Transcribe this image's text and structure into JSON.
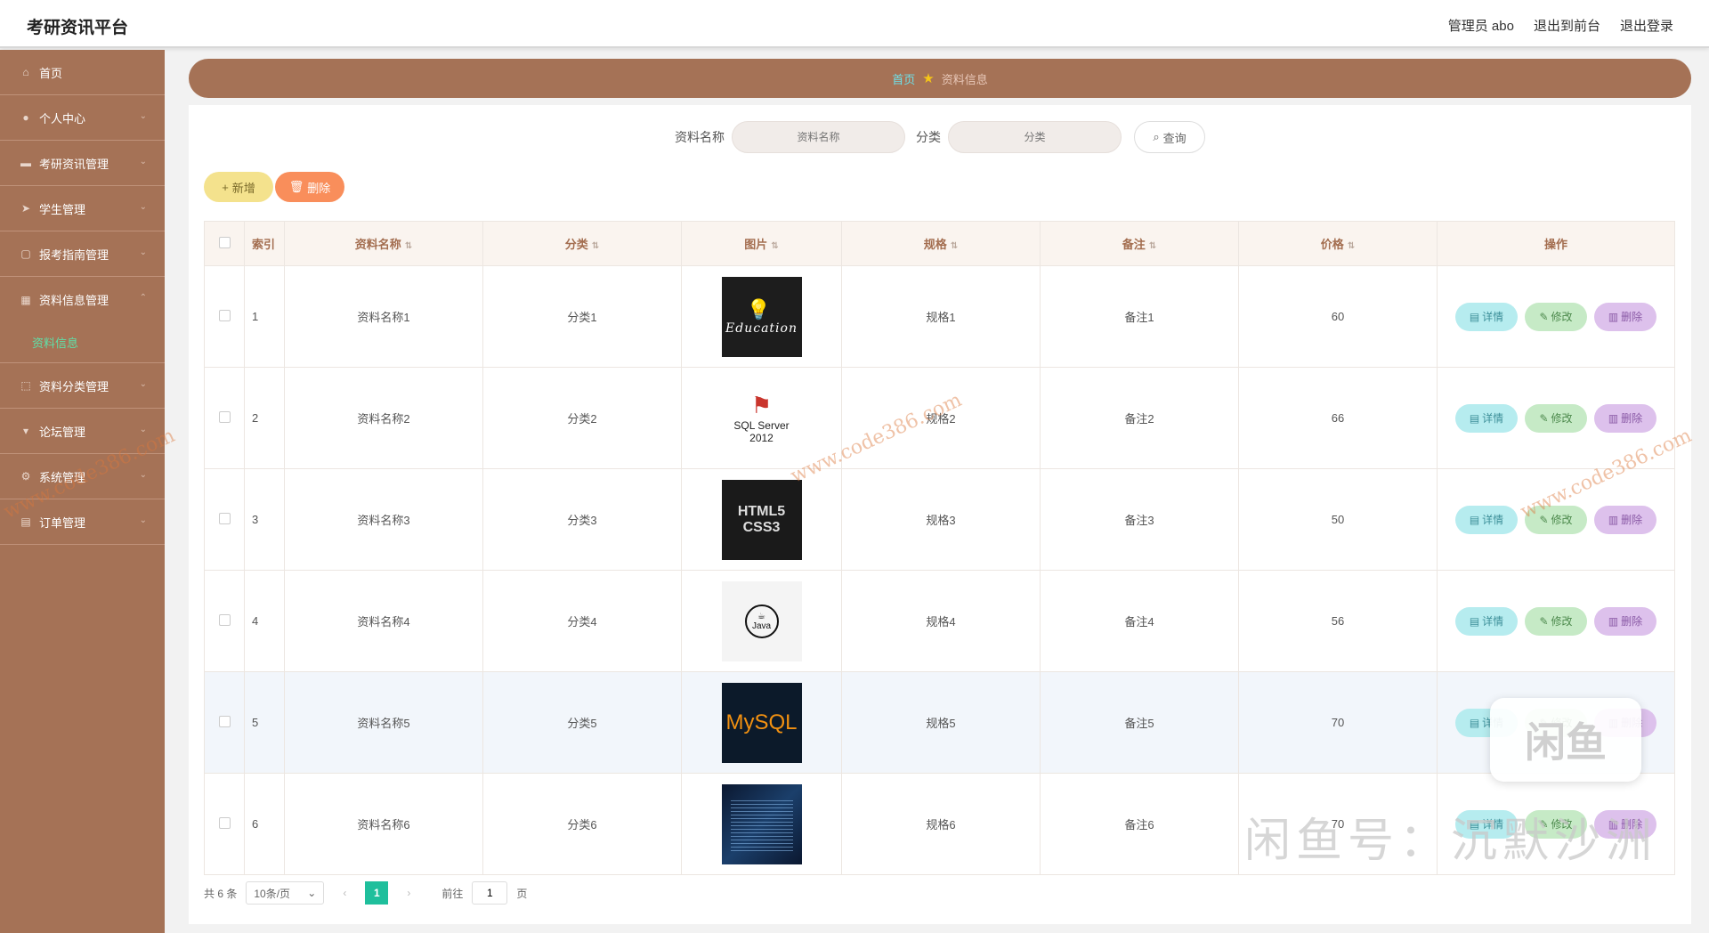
{
  "header": {
    "brand": "考研资讯平台",
    "user": "管理员 abo",
    "front_link": "退出到前台",
    "logout": "退出登录"
  },
  "sidebar": {
    "items": [
      {
        "label": "首页",
        "icon": "home-icon"
      },
      {
        "label": "个人中心",
        "icon": "user-icon"
      },
      {
        "label": "考研资讯管理",
        "icon": "news-icon"
      },
      {
        "label": "学生管理",
        "icon": "student-icon"
      },
      {
        "label": "报考指南管理",
        "icon": "guide-icon"
      },
      {
        "label": "资料信息管理",
        "icon": "folder-icon"
      },
      {
        "label": "资料分类管理",
        "icon": "category-icon"
      },
      {
        "label": "论坛管理",
        "icon": "forum-icon"
      },
      {
        "label": "系统管理",
        "icon": "settings-icon"
      },
      {
        "label": "订单管理",
        "icon": "order-icon"
      }
    ],
    "active_sub": "资料信息"
  },
  "breadcrumb": {
    "home": "首页",
    "current": "资料信息"
  },
  "search": {
    "name_label": "资料名称",
    "name_placeholder": "资料名称",
    "category_label": "分类",
    "category_placeholder": "分类",
    "query_button": "查询"
  },
  "toolbar": {
    "add": "新增",
    "delete": "删除"
  },
  "table": {
    "headers": {
      "index": "索引",
      "name": "资料名称",
      "category": "分类",
      "image": "图片",
      "spec": "规格",
      "remark": "备注",
      "price": "价格",
      "ops": "操作"
    },
    "rows": [
      {
        "index": "1",
        "name": "资料名称1",
        "category": "分类1",
        "image": "Education",
        "spec": "规格1",
        "remark": "备注1",
        "price": "60"
      },
      {
        "index": "2",
        "name": "资料名称2",
        "category": "分类2",
        "image": "SQL Server 2012",
        "spec": "规格2",
        "remark": "备注2",
        "price": "66"
      },
      {
        "index": "3",
        "name": "资料名称3",
        "category": "分类3",
        "image": "HTML5 CSS3",
        "spec": "规格3",
        "remark": "备注3",
        "price": "50"
      },
      {
        "index": "4",
        "name": "资料名称4",
        "category": "分类4",
        "image": "Java",
        "spec": "规格4",
        "remark": "备注4",
        "price": "56"
      },
      {
        "index": "5",
        "name": "资料名称5",
        "category": "分类5",
        "image": "MySQL",
        "spec": "规格5",
        "remark": "备注5",
        "price": "70"
      },
      {
        "index": "6",
        "name": "资料名称6",
        "category": "分类6",
        "image": "code",
        "spec": "规格6",
        "remark": "备注6",
        "price": "70"
      }
    ],
    "op_labels": {
      "detail": "详情",
      "edit": "修改",
      "delete": "删除"
    }
  },
  "pagination": {
    "total": "共 6 条",
    "page_size": "10条/页",
    "current_page": "1",
    "goto_label": "前往",
    "goto_value": "1",
    "page_suffix": "页"
  },
  "watermarks": {
    "site": "www.code386.com",
    "badge": "闲鱼",
    "caption": "闲鱼号：沉默沙洲"
  },
  "colors": {
    "sidebar": "#a57256",
    "active_sub": "#5fe0a8",
    "accent_page": "#1fbf9c"
  }
}
